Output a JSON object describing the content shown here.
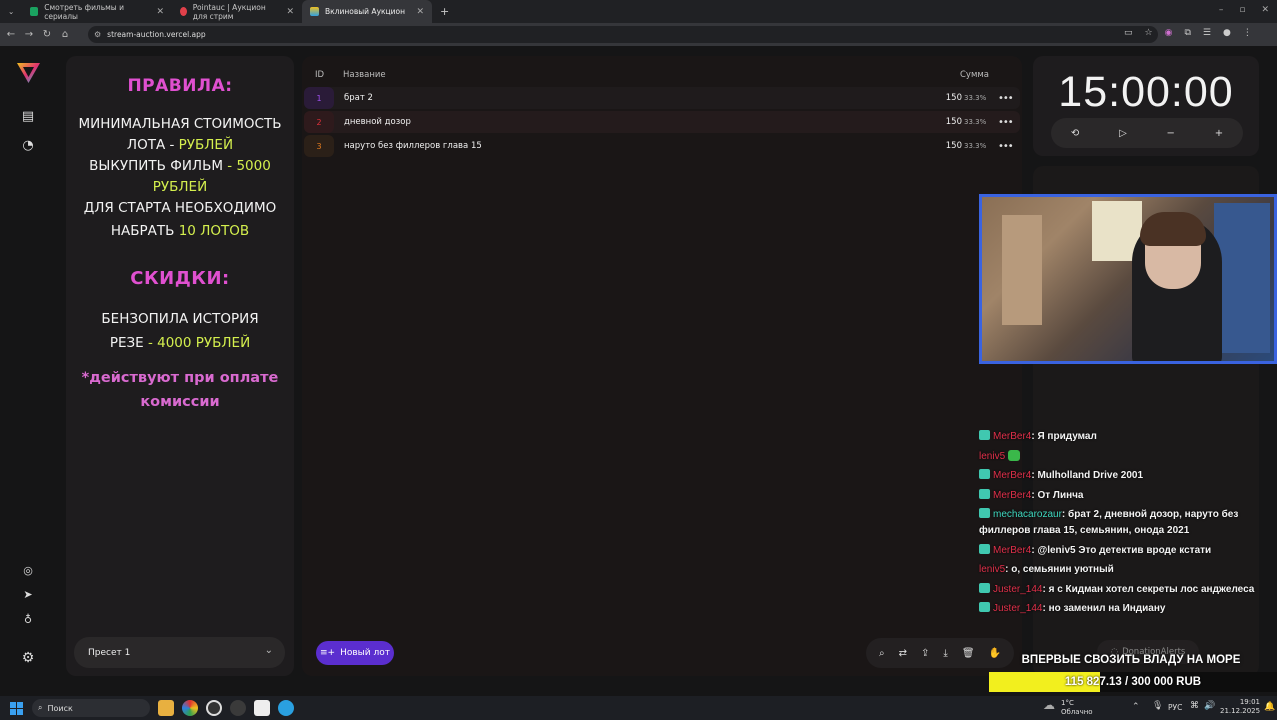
{
  "browser": {
    "tabs": [
      {
        "title": "Смотреть фильмы и сериалы",
        "active": false,
        "favicon_color": "#1aa260"
      },
      {
        "title": "Pointauc | Аукцион для стрим",
        "active": false,
        "favicon_color": "#e0404a"
      },
      {
        "title": "Вклиновый Аукцион",
        "active": true,
        "favicon_color": "#f0c020"
      }
    ],
    "url": "stream-auction.vercel.app"
  },
  "rules": {
    "heading": "ПРАВИЛА:",
    "line1": "МИНИМАЛЬНАЯ СТОИМОСТЬ",
    "line2_a": "ЛОТА - ",
    "line2_b": "РУБЛЕЙ",
    "line3_a": "ВЫКУПИТЬ ФИЛЬМ",
    "line3_b": " - 5000",
    "line4": "РУБЛЕЙ",
    "line5": "ДЛЯ СТАРТА НЕОБХОДИМО",
    "line6_a": "НАБРАТЬ ",
    "line6_b": "10 ЛОТОВ",
    "discounts_heading": "СКИДКИ:",
    "disc_line1": "БЕНЗОПИЛА ИСТОРИЯ",
    "disc_line2_a": "РЕЗЕ",
    "disc_line2_b": " - 4000 РУБЛЕЙ",
    "note_line1": "*действуют при оплате",
    "note_line2": "комиссии"
  },
  "preset": {
    "label": "Пресет 1"
  },
  "table": {
    "headers": {
      "id": "ID",
      "name": "Название",
      "sum": "Сумма"
    },
    "rows": [
      {
        "id": "1",
        "name": "брат 2",
        "sum": "150",
        "pct": "33.3%",
        "color": "#8a2be2"
      },
      {
        "id": "2",
        "name": "дневной дозор",
        "sum": "150",
        "pct": "33.3%",
        "color": "#e0303a"
      },
      {
        "id": "3",
        "name": "наруто без филлеров глава 15",
        "sum": "150",
        "pct": "33.3%",
        "color": "#e07a20"
      }
    ]
  },
  "buttons": {
    "new_lot": "Новый лот"
  },
  "timer": {
    "value": "15:00:00"
  },
  "chat": [
    {
      "user": "MerBer4",
      "text": ": Я придумал",
      "user_color": "#e0304a"
    },
    {
      "user": "leniv5",
      "text": " ",
      "user_color": "#e0304a",
      "emote": true
    },
    {
      "user": "MerBer4",
      "text": ": Mulholland Drive 2001",
      "user_color": "#e0304a"
    },
    {
      "user": "MerBer4",
      "text": ": От Линча",
      "user_color": "#e0304a"
    },
    {
      "user": "mechacarozaur",
      "text": ": брат 2, дневной дозор, наруто без филлеров глава 15, семьянин, онода 2021",
      "user_color": "#3fd8c0"
    },
    {
      "user": "MerBer4",
      "text": ": @leniv5 Это детектив вроде кстати",
      "user_color": "#e0304a"
    },
    {
      "user": "leniv5",
      "text": ": о, семьянин уютный",
      "user_color": "#e0304a"
    },
    {
      "user": "Juster_144",
      "text": ": я с Кидман хотел секреты лос анджелеса",
      "user_color": "#e0304a"
    },
    {
      "user": "Juster_144",
      "text": ": но заменил на Индиану",
      "user_color": "#e0304a"
    }
  ],
  "donation": {
    "label": "DonationAlerts"
  },
  "goal": {
    "title": "ВПЕРВЫЕ СВОЗИТЬ ВЛАДУ НА МОРЕ",
    "text": "115 827.13 / 300 000 RUB",
    "progress": 0.386
  },
  "taskbar": {
    "search_placeholder": "Поиск",
    "weather_temp": "1°C",
    "weather_desc": "Облачно",
    "lang": "РУС",
    "time": "19:01",
    "date": "21.12.2025"
  },
  "colors": {
    "accent": "#5b2ecf",
    "rules_heading": "#e050d0",
    "highlight": "#d4ef4e",
    "goal_fill": "#f2ef1e"
  }
}
